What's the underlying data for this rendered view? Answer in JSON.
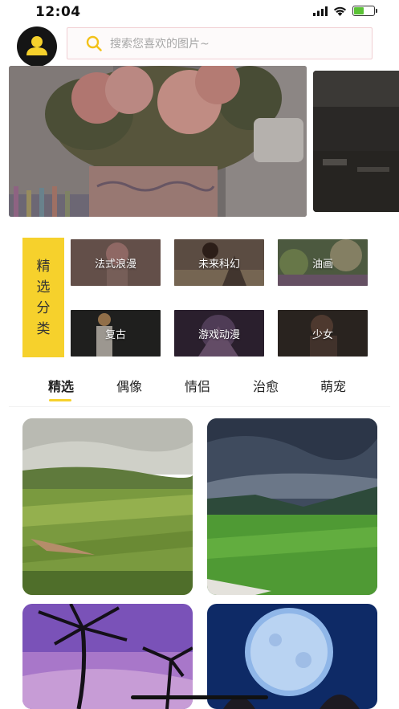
{
  "status_bar": {
    "time": "12:04",
    "battery_level": 0.55,
    "battery_color": "#5bc236"
  },
  "search": {
    "placeholder": "搜索您喜欢的图片~",
    "icon": "search-icon"
  },
  "accent_color": "#f6d12c",
  "categories": {
    "label": [
      "精",
      "选",
      "分",
      "类"
    ],
    "items": [
      {
        "label": "法式浪漫"
      },
      {
        "label": "未来科幻"
      },
      {
        "label": "油画"
      },
      {
        "label": "复古"
      },
      {
        "label": "游戏动漫"
      },
      {
        "label": "少女"
      }
    ]
  },
  "tabs": [
    {
      "label": "精选",
      "active": true
    },
    {
      "label": "偶像",
      "active": false
    },
    {
      "label": "情侣",
      "active": false
    },
    {
      "label": "治愈",
      "active": false
    },
    {
      "label": "萌宠",
      "active": false
    }
  ]
}
